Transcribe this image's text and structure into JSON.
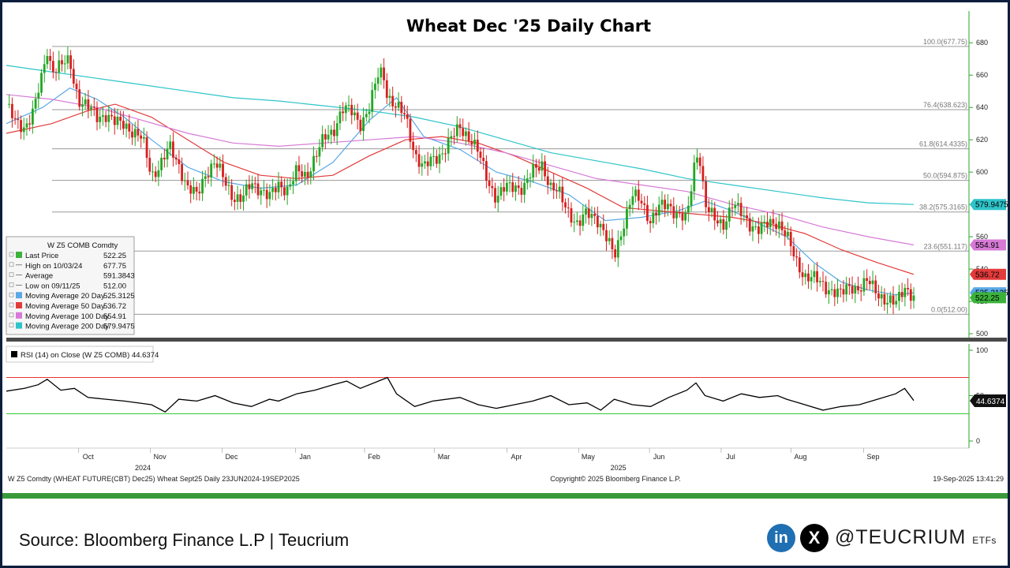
{
  "chart_data": {
    "type": "candlestick",
    "title": "Wheat Dec '25 Daily Chart",
    "ylim": [
      500,
      685
    ],
    "y_ticks": [
      500,
      520,
      540,
      560,
      580,
      600,
      620,
      640,
      660,
      680
    ],
    "months": [
      {
        "label": "Oct",
        "x": 0.045
      },
      {
        "label": "Nov",
        "x": 0.124
      },
      {
        "label": "Dec",
        "x": 0.203
      },
      {
        "label": "Jan",
        "x": 0.284
      },
      {
        "label": "Feb",
        "x": 0.36
      },
      {
        "label": "Mar",
        "x": 0.437
      },
      {
        "label": "Apr",
        "x": 0.517
      },
      {
        "label": "May",
        "x": 0.596
      },
      {
        "label": "Jun",
        "x": 0.674
      },
      {
        "label": "Jul",
        "x": 0.753
      },
      {
        "label": "Aug",
        "x": 0.83
      },
      {
        "label": "Sep",
        "x": 0.91
      }
    ],
    "year_labels": [
      {
        "label": "2024",
        "x": 0.1
      },
      {
        "label": "2025",
        "x": 0.624
      }
    ],
    "fib_levels": [
      {
        "label": "100.0(677.75)",
        "value": 677.75
      },
      {
        "label": "76.4(638.623)",
        "value": 638.623
      },
      {
        "label": "61.8(614.4335)",
        "value": 614.4335
      },
      {
        "label": "50.0(594.875)",
        "value": 594.875
      },
      {
        "label": "38.2(575.3165)",
        "value": 575.3165
      },
      {
        "label": "23.6(551.117)",
        "value": 551.117
      },
      {
        "label": "0.0(512.00)",
        "value": 512.0
      }
    ],
    "close_path": [
      [
        0.0,
        642
      ],
      [
        0.01,
        630
      ],
      [
        0.02,
        628
      ],
      [
        0.03,
        638
      ],
      [
        0.04,
        660
      ],
      [
        0.045,
        676
      ],
      [
        0.05,
        664
      ],
      [
        0.06,
        666
      ],
      [
        0.07,
        668
      ],
      [
        0.075,
        655
      ],
      [
        0.08,
        645
      ],
      [
        0.09,
        640
      ],
      [
        0.1,
        634
      ],
      [
        0.11,
        636
      ],
      [
        0.12,
        630
      ],
      [
        0.13,
        630
      ],
      [
        0.14,
        625
      ],
      [
        0.15,
        620
      ],
      [
        0.16,
        598
      ],
      [
        0.17,
        605
      ],
      [
        0.18,
        615
      ],
      [
        0.19,
        605
      ],
      [
        0.2,
        590
      ],
      [
        0.21,
        585
      ],
      [
        0.22,
        600
      ],
      [
        0.23,
        606
      ],
      [
        0.24,
        595
      ],
      [
        0.25,
        585
      ],
      [
        0.26,
        583
      ],
      [
        0.27,
        593
      ],
      [
        0.28,
        590
      ],
      [
        0.29,
        584
      ],
      [
        0.3,
        592
      ],
      [
        0.31,
        590
      ],
      [
        0.32,
        600
      ],
      [
        0.33,
        597
      ],
      [
        0.34,
        610
      ],
      [
        0.35,
        620
      ],
      [
        0.36,
        625
      ],
      [
        0.37,
        640
      ],
      [
        0.38,
        637
      ],
      [
        0.39,
        630
      ],
      [
        0.4,
        640
      ],
      [
        0.41,
        660
      ],
      [
        0.415,
        662
      ],
      [
        0.42,
        648
      ],
      [
        0.43,
        640
      ],
      [
        0.44,
        634
      ],
      [
        0.45,
        612
      ],
      [
        0.46,
        602
      ],
      [
        0.47,
        608
      ],
      [
        0.48,
        612
      ],
      [
        0.49,
        620
      ],
      [
        0.5,
        628
      ],
      [
        0.51,
        622
      ],
      [
        0.52,
        612
      ],
      [
        0.53,
        596
      ],
      [
        0.54,
        584
      ],
      [
        0.55,
        590
      ],
      [
        0.56,
        592
      ],
      [
        0.57,
        590
      ],
      [
        0.58,
        600
      ],
      [
        0.59,
        606
      ],
      [
        0.6,
        590
      ],
      [
        0.61,
        586
      ],
      [
        0.62,
        576
      ],
      [
        0.63,
        566
      ],
      [
        0.64,
        575
      ],
      [
        0.65,
        573
      ],
      [
        0.66,
        560
      ],
      [
        0.67,
        548
      ],
      [
        0.68,
        568
      ],
      [
        0.69,
        585
      ],
      [
        0.7,
        582
      ],
      [
        0.71,
        570
      ],
      [
        0.72,
        578
      ],
      [
        0.73,
        580
      ],
      [
        0.74,
        574
      ],
      [
        0.75,
        570
      ],
      [
        0.76,
        612
      ],
      [
        0.765,
        608
      ],
      [
        0.77,
        580
      ],
      [
        0.78,
        570
      ],
      [
        0.79,
        568
      ],
      [
        0.8,
        580
      ],
      [
        0.81,
        574
      ],
      [
        0.82,
        568
      ],
      [
        0.83,
        564
      ],
      [
        0.84,
        568
      ],
      [
        0.85,
        570
      ],
      [
        0.86,
        560
      ],
      [
        0.87,
        545
      ],
      [
        0.88,
        536
      ],
      [
        0.89,
        534
      ],
      [
        0.9,
        530
      ],
      [
        0.91,
        527
      ],
      [
        0.92,
        524
      ],
      [
        0.93,
        530
      ],
      [
        0.94,
        528
      ],
      [
        0.95,
        532
      ],
      [
        0.96,
        526
      ],
      [
        0.97,
        520
      ],
      [
        0.98,
        518
      ],
      [
        0.99,
        530
      ],
      [
        1.0,
        522
      ]
    ],
    "series": [
      {
        "name": "Moving Average 20 Day",
        "color": "#5aa9e6",
        "path": [
          [
            0.0,
            630
          ],
          [
            0.04,
            640
          ],
          [
            0.07,
            652
          ],
          [
            0.1,
            645
          ],
          [
            0.13,
            634
          ],
          [
            0.16,
            620
          ],
          [
            0.2,
            603
          ],
          [
            0.24,
            594
          ],
          [
            0.28,
            590
          ],
          [
            0.32,
            592
          ],
          [
            0.36,
            606
          ],
          [
            0.4,
            632
          ],
          [
            0.43,
            646
          ],
          [
            0.46,
            622
          ],
          [
            0.5,
            614
          ],
          [
            0.54,
            600
          ],
          [
            0.58,
            594
          ],
          [
            0.62,
            586
          ],
          [
            0.66,
            570
          ],
          [
            0.7,
            572
          ],
          [
            0.74,
            576
          ],
          [
            0.77,
            582
          ],
          [
            0.8,
            576
          ],
          [
            0.83,
            568
          ],
          [
            0.86,
            560
          ],
          [
            0.89,
            544
          ],
          [
            0.92,
            532
          ],
          [
            0.95,
            527
          ],
          [
            0.98,
            524
          ],
          [
            1.0,
            525.31
          ]
        ]
      },
      {
        "name": "Moving Average 50 Day",
        "color": "#e23b3b",
        "path": [
          [
            0.0,
            624
          ],
          [
            0.05,
            630
          ],
          [
            0.09,
            638
          ],
          [
            0.12,
            642
          ],
          [
            0.16,
            634
          ],
          [
            0.2,
            620
          ],
          [
            0.24,
            606
          ],
          [
            0.28,
            598
          ],
          [
            0.32,
            596
          ],
          [
            0.36,
            598
          ],
          [
            0.4,
            610
          ],
          [
            0.44,
            620
          ],
          [
            0.48,
            622
          ],
          [
            0.52,
            618
          ],
          [
            0.56,
            610
          ],
          [
            0.6,
            600
          ],
          [
            0.64,
            590
          ],
          [
            0.68,
            578
          ],
          [
            0.72,
            576
          ],
          [
            0.76,
            574
          ],
          [
            0.8,
            572
          ],
          [
            0.84,
            568
          ],
          [
            0.88,
            562
          ],
          [
            0.92,
            552
          ],
          [
            0.96,
            544
          ],
          [
            1.0,
            536.72
          ]
        ]
      },
      {
        "name": "Moving Average 100 Day",
        "color": "#d67ad6",
        "path": [
          [
            0.0,
            648
          ],
          [
            0.05,
            645
          ],
          [
            0.1,
            640
          ],
          [
            0.15,
            632
          ],
          [
            0.2,
            624
          ],
          [
            0.25,
            618
          ],
          [
            0.3,
            616
          ],
          [
            0.35,
            618
          ],
          [
            0.4,
            620
          ],
          [
            0.45,
            622
          ],
          [
            0.5,
            618
          ],
          [
            0.55,
            612
          ],
          [
            0.6,
            604
          ],
          [
            0.65,
            596
          ],
          [
            0.7,
            592
          ],
          [
            0.75,
            588
          ],
          [
            0.8,
            580
          ],
          [
            0.85,
            574
          ],
          [
            0.9,
            566
          ],
          [
            0.95,
            560
          ],
          [
            1.0,
            554.91
          ]
        ]
      },
      {
        "name": "Moving Average 200 Day",
        "color": "#2ec4c9",
        "path": [
          [
            0.0,
            666
          ],
          [
            0.05,
            662
          ],
          [
            0.1,
            658
          ],
          [
            0.15,
            654
          ],
          [
            0.2,
            650
          ],
          [
            0.25,
            646
          ],
          [
            0.3,
            644
          ],
          [
            0.35,
            641
          ],
          [
            0.4,
            638
          ],
          [
            0.45,
            634
          ],
          [
            0.5,
            628
          ],
          [
            0.55,
            620
          ],
          [
            0.6,
            612
          ],
          [
            0.65,
            607
          ],
          [
            0.7,
            602
          ],
          [
            0.75,
            596
          ],
          [
            0.8,
            592
          ],
          [
            0.85,
            588
          ],
          [
            0.9,
            584
          ],
          [
            0.95,
            581
          ],
          [
            1.0,
            579.95
          ]
        ]
      }
    ],
    "legend": {
      "header": "W Z5 COMB Comdty",
      "rows": [
        {
          "label": "Last Price",
          "value": "522.25",
          "color": "#3bb33b"
        },
        {
          "label": "High on 10/03/24",
          "value": "677.75",
          "color": ""
        },
        {
          "label": "Average",
          "value": "591.3843",
          "color": ""
        },
        {
          "label": "Low on 09/11/25",
          "value": "512.00",
          "color": ""
        },
        {
          "label": "Moving Average 20 Day",
          "value": "525.3125",
          "color": "#5aa9e6"
        },
        {
          "label": "Moving Average 50 Day",
          "value": "536.72",
          "color": "#e23b3b"
        },
        {
          "label": "Moving Average 100 Day",
          "value": "554.91",
          "color": "#d67ad6"
        },
        {
          "label": "Moving Average 200 Day",
          "value": "579.9475",
          "color": "#2ec4c9"
        }
      ]
    },
    "value_tags": [
      {
        "value": 579.9475,
        "label": "579.9475",
        "color": "#2ec4c9"
      },
      {
        "value": 554.91,
        "label": "554.91",
        "color": "#d67ad6"
      },
      {
        "value": 536.72,
        "label": "536.72",
        "color": "#e23b3b"
      },
      {
        "value": 525.3125,
        "label": "525.3125",
        "color": "#5aa9e6"
      },
      {
        "value": 522.25,
        "label": "522.25",
        "color": "#3bb33b"
      }
    ],
    "rsi": {
      "label": "RSI (14)  on Close (W Z5 COMB) 44.6374",
      "value": 44.6374,
      "value_label": "44.6374",
      "ylim": [
        0,
        100
      ],
      "y_ticks": [
        0,
        50,
        100
      ],
      "levels": [
        70,
        30
      ],
      "path": [
        [
          0.0,
          55
        ],
        [
          0.02,
          58
        ],
        [
          0.035,
          62
        ],
        [
          0.045,
          68
        ],
        [
          0.06,
          56
        ],
        [
          0.075,
          58
        ],
        [
          0.09,
          48
        ],
        [
          0.11,
          46
        ],
        [
          0.13,
          44
        ],
        [
          0.16,
          40
        ],
        [
          0.175,
          32
        ],
        [
          0.19,
          46
        ],
        [
          0.21,
          44
        ],
        [
          0.23,
          50
        ],
        [
          0.25,
          42
        ],
        [
          0.27,
          38
        ],
        [
          0.29,
          46
        ],
        [
          0.3,
          44
        ],
        [
          0.32,
          52
        ],
        [
          0.34,
          56
        ],
        [
          0.36,
          62
        ],
        [
          0.375,
          66
        ],
        [
          0.39,
          58
        ],
        [
          0.41,
          66
        ],
        [
          0.42,
          70
        ],
        [
          0.43,
          52
        ],
        [
          0.45,
          38
        ],
        [
          0.47,
          44
        ],
        [
          0.5,
          48
        ],
        [
          0.52,
          40
        ],
        [
          0.54,
          36
        ],
        [
          0.56,
          40
        ],
        [
          0.58,
          44
        ],
        [
          0.6,
          50
        ],
        [
          0.62,
          40
        ],
        [
          0.64,
          42
        ],
        [
          0.655,
          34
        ],
        [
          0.67,
          46
        ],
        [
          0.69,
          40
        ],
        [
          0.71,
          38
        ],
        [
          0.73,
          48
        ],
        [
          0.75,
          56
        ],
        [
          0.76,
          64
        ],
        [
          0.77,
          50
        ],
        [
          0.79,
          44
        ],
        [
          0.81,
          52
        ],
        [
          0.83,
          48
        ],
        [
          0.85,
          50
        ],
        [
          0.86,
          46
        ],
        [
          0.88,
          40
        ],
        [
          0.9,
          34
        ],
        [
          0.92,
          38
        ],
        [
          0.94,
          40
        ],
        [
          0.96,
          46
        ],
        [
          0.98,
          52
        ],
        [
          0.99,
          58
        ],
        [
          1.0,
          44.64
        ]
      ]
    }
  },
  "footer_strip": {
    "left": "W Z5 Comdty (WHEAT FUTURE(CBT) Dec25) Wheat Sept25  Daily 23JUN2024-19SEP2025",
    "center": "Copyright© 2025 Bloomberg Finance L.P.",
    "right": "19-Sep-2025 13:41:29"
  },
  "source": "Source: Bloomberg Finance L.P | Teucrium",
  "social": {
    "linkedin_icon": "in",
    "x_icon": "X",
    "handle": "@TEUCRIUM",
    "handle_suffix": "ETFs"
  },
  "colors": {
    "up_candle": "#22a622",
    "down_candle": "#d81f1f",
    "rsi_line": "#000000",
    "rsi_levels": "#e33",
    "bottom_rule": "#3a9a3a"
  }
}
